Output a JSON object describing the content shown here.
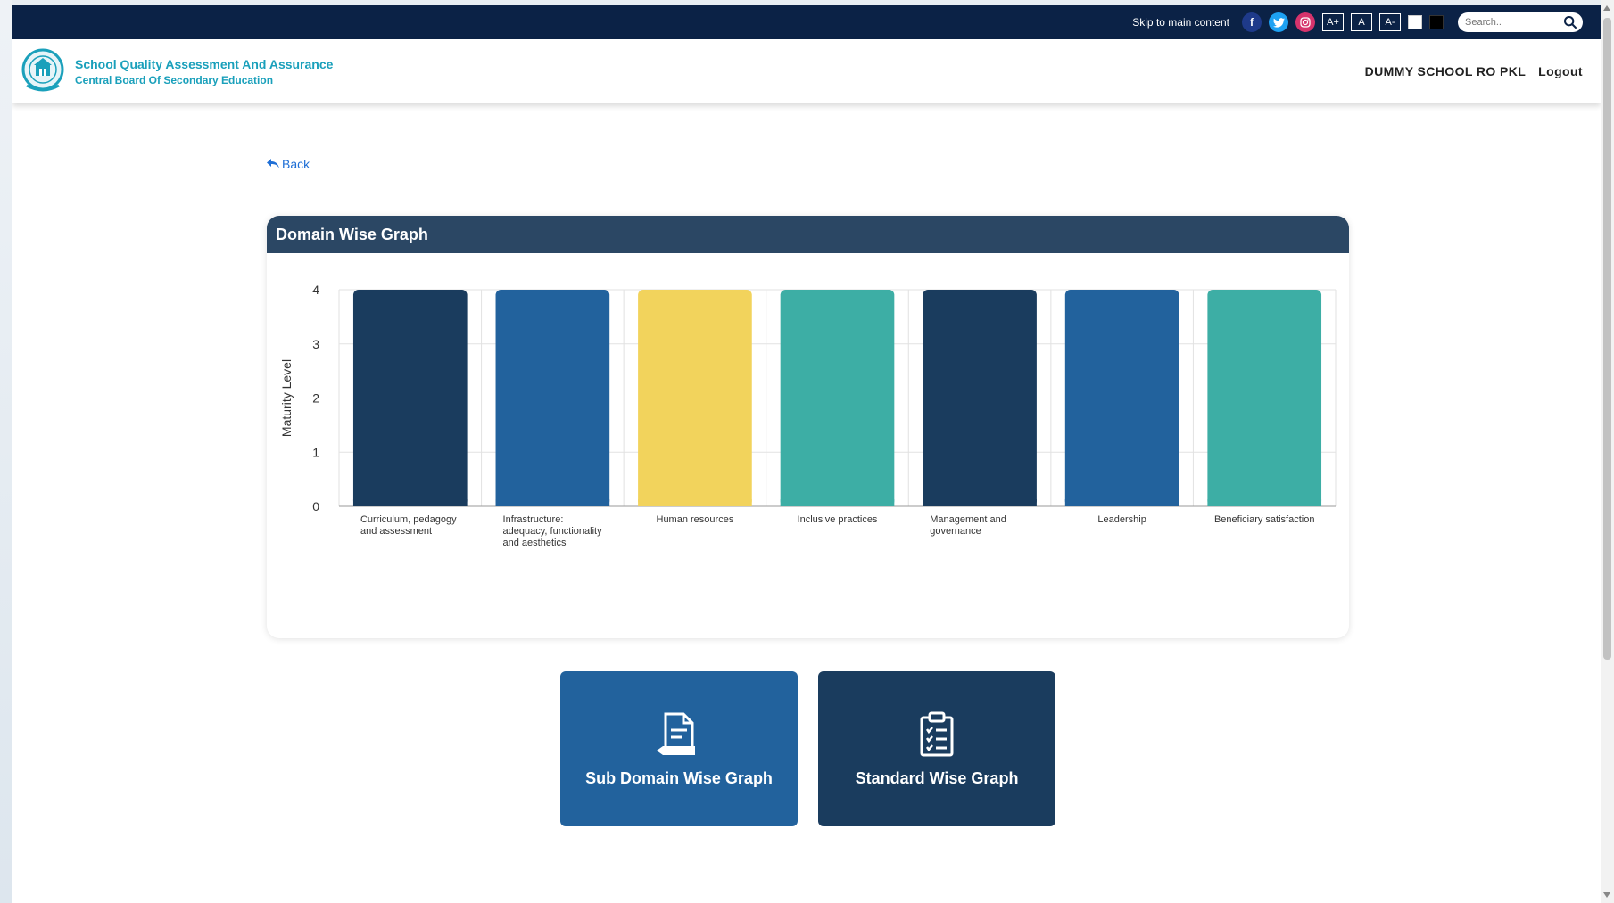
{
  "topbar": {
    "skip_label": "Skip to main content",
    "facebook_glyph": "f",
    "twitter_glyph": "t",
    "instagram_glyph": "◎",
    "font_increase": "A+",
    "font_normal": "A",
    "font_decrease": "A-",
    "search_placeholder": "Search.."
  },
  "header": {
    "title": "School Quality Assessment And Assurance",
    "subtitle": "Central Board Of Secondary Education",
    "user": "DUMMY SCHOOL RO PKL",
    "logout": "Logout"
  },
  "back_label": "Back",
  "card": {
    "title": "Domain Wise Graph"
  },
  "chart_data": {
    "type": "bar",
    "ylabel": "Maturity Level",
    "xlabel": "",
    "ylim": [
      0,
      4
    ],
    "yticks": [
      0,
      1,
      2,
      3,
      4
    ],
    "grid": true,
    "categories": [
      [
        "Curriculum, pedagogy",
        "and assessment"
      ],
      [
        "Infrastructure:",
        "adequacy, functionality",
        "and aesthetics"
      ],
      [
        "Human resources"
      ],
      [
        "Inclusive practices"
      ],
      [
        "Management and",
        "governance"
      ],
      [
        "Leadership"
      ],
      [
        "Beneficiary satisfaction"
      ]
    ],
    "values": [
      4,
      4,
      4,
      4,
      4,
      4,
      4
    ],
    "colors": [
      "#1a3c5e",
      "#22629d",
      "#f2d35c",
      "#3daea5",
      "#1a3c5e",
      "#22629d",
      "#3daea5"
    ]
  },
  "buttons": {
    "sub_domain": "Sub Domain Wise Graph",
    "standard": "Standard Wise Graph"
  },
  "colors": {
    "topbar": "#0b2246",
    "brand": "#1aa0bb",
    "card_header": "#2b4764",
    "link": "#1f6fd6"
  }
}
